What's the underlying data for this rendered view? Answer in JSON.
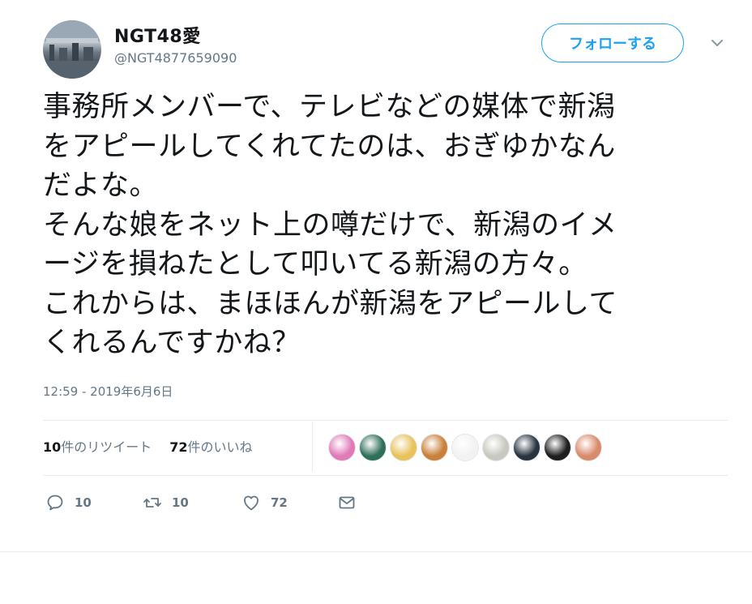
{
  "user": {
    "display_name": "NGT48愛",
    "screen_name": "@NGT4877659090",
    "avatar": "avatar-photo"
  },
  "follow_button": {
    "label": "フォローする"
  },
  "menu_icon": "chevron-down-icon",
  "tweet": {
    "text": "事務所メンバーで、テレビなどの媒体で新潟\nをアピールしてくれてたのは、おぎゆかなん\nだよな。\nそんな娘をネット上の噂だけで、新潟のイメ\nージを損ねたとして叩いてる新潟の方々。\nこれからは、まほほんが新潟をアピールして\nくれるんですかね？",
    "timestamp": "12:59 - 2019年6月6日"
  },
  "stats": {
    "retweets_count": "10",
    "retweets_label": "件のリツイート",
    "likes_count": "72",
    "likes_label": "件のいいね"
  },
  "liker_avatars": [
    {
      "color": "#e07ab8"
    },
    {
      "color": "#2f6f5a"
    },
    {
      "color": "#e8c25a"
    },
    {
      "color": "#c9803a"
    },
    {
      "color": "#f2f2f2"
    },
    {
      "color": "#c8c8c0"
    },
    {
      "color": "#2a3440"
    },
    {
      "color": "#1e1e1e"
    },
    {
      "color": "#d98a6a"
    }
  ],
  "actions": {
    "reply_count": "10",
    "retweet_count": "10",
    "like_count": "72"
  },
  "colors": {
    "accent": "#1da1f2",
    "secondary_text": "#657786",
    "divider": "#e6ecf0"
  }
}
